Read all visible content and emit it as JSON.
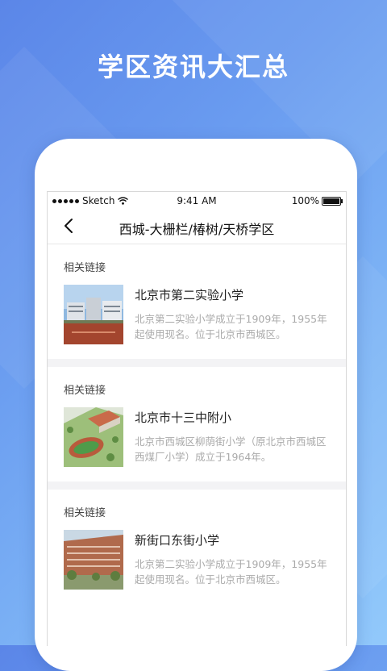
{
  "banner": {
    "title": "学区资讯大汇总"
  },
  "status_bar": {
    "carrier": "Sketch",
    "time": "9:41 AM",
    "battery": "100%"
  },
  "nav": {
    "title": "西城-大栅栏/椿树/天桥学区",
    "back_icon": "chevron-left-icon"
  },
  "sections": [
    {
      "label": "相关链接",
      "name": "北京市第二实验小学",
      "desc": "北京第二实验小学成立于1909年，1955年起使用现名。位于北京市西城区。",
      "thumb": "school-building-photo"
    },
    {
      "label": "相关链接",
      "name": "北京市十三中附小",
      "desc": "北京市西城区柳荫街小学（原北京市西城区西煤厂小学）成立于1964年。",
      "thumb": "campus-aerial-photo"
    },
    {
      "label": "相关链接",
      "name": "新街口东街小学",
      "desc": "北京第二实验小学成立于1909年，1955年起使用现名。位于北京市西城区。",
      "thumb": "school-facade-photo"
    }
  ],
  "colors": {
    "background_start": "#5b86e8",
    "background_end": "#92c9fb",
    "text_primary": "#222222",
    "text_secondary": "#aaaaaa"
  }
}
